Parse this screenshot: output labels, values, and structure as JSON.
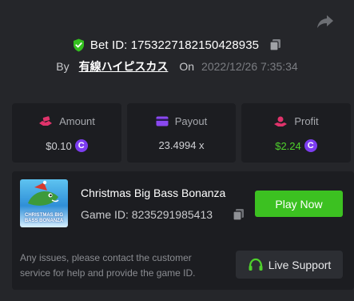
{
  "header": {
    "bet_id_label": "Bet ID: 1753227182150428935",
    "by_label": "By",
    "username": "有線ハイピスカス",
    "on_label": "On",
    "timestamp": "2022/12/26 7:35:34",
    "icons": {
      "shield": "shield-check-icon",
      "copy": "copy-icon",
      "share": "share-icon"
    }
  },
  "stats": [
    {
      "label": "Amount",
      "value": "$0.10",
      "icon": "money-hand-icon"
    },
    {
      "label": "Payout",
      "value": "23.4994 x",
      "icon": "card-icon"
    },
    {
      "label": "Profit",
      "value": "$2.24",
      "icon": "hand-coin-icon"
    }
  ],
  "game": {
    "title": "Christmas Big Bass Bonanza",
    "game_id_label": "Game ID: 8235291985413",
    "thumbnail_text": "CHRISTMAS BIG BASS BONANZA",
    "play_label": "Play Now"
  },
  "support": {
    "message": "Any issues, please contact the customer service for help and provide the game ID.",
    "button_label": "Live Support"
  },
  "colors": {
    "background": "#25262a",
    "card": "#1c1d21",
    "green": "#3cc121",
    "coin": "#7c3df0",
    "amount_icon": "#e0336b",
    "payout_icon": "#8a48f0",
    "profit_icon": "#e0336b"
  }
}
